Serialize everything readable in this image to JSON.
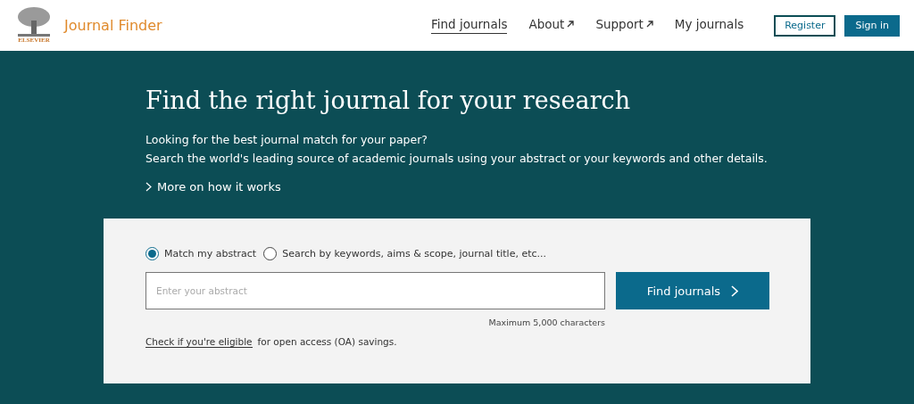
{
  "header": {
    "logo": {
      "wordmark": "ELSEVIER",
      "product": "Journal Finder"
    },
    "nav": [
      {
        "label": "Find journals",
        "selected": true,
        "external": false
      },
      {
        "label": "About",
        "selected": false,
        "external": true
      },
      {
        "label": "Support",
        "selected": false,
        "external": true
      },
      {
        "label": "My journals",
        "selected": false,
        "external": false
      }
    ],
    "buttons": [
      {
        "label": "Register",
        "kind": "outline"
      },
      {
        "label": "Sign in",
        "kind": "filled"
      }
    ]
  },
  "hero": {
    "title": "Find the right journal for your research",
    "lines": [
      "Looking for the best journal match for your paper?",
      "Search the world's leading source of academic journals using your abstract or your keywords and other details."
    ],
    "more_link": "More on how it works"
  },
  "search": {
    "modes": [
      {
        "label": "Match my abstract",
        "selected": true
      },
      {
        "label": "Search by keywords, aims & scope, journal title, etc...",
        "selected": false
      }
    ],
    "placeholder": "Enter your abstract",
    "submit": "Find journals",
    "limit": "Maximum 5,000 characters",
    "eligibility_link": "Check if you're eligible",
    "eligibility_text": "for open access (OA) savings."
  }
}
